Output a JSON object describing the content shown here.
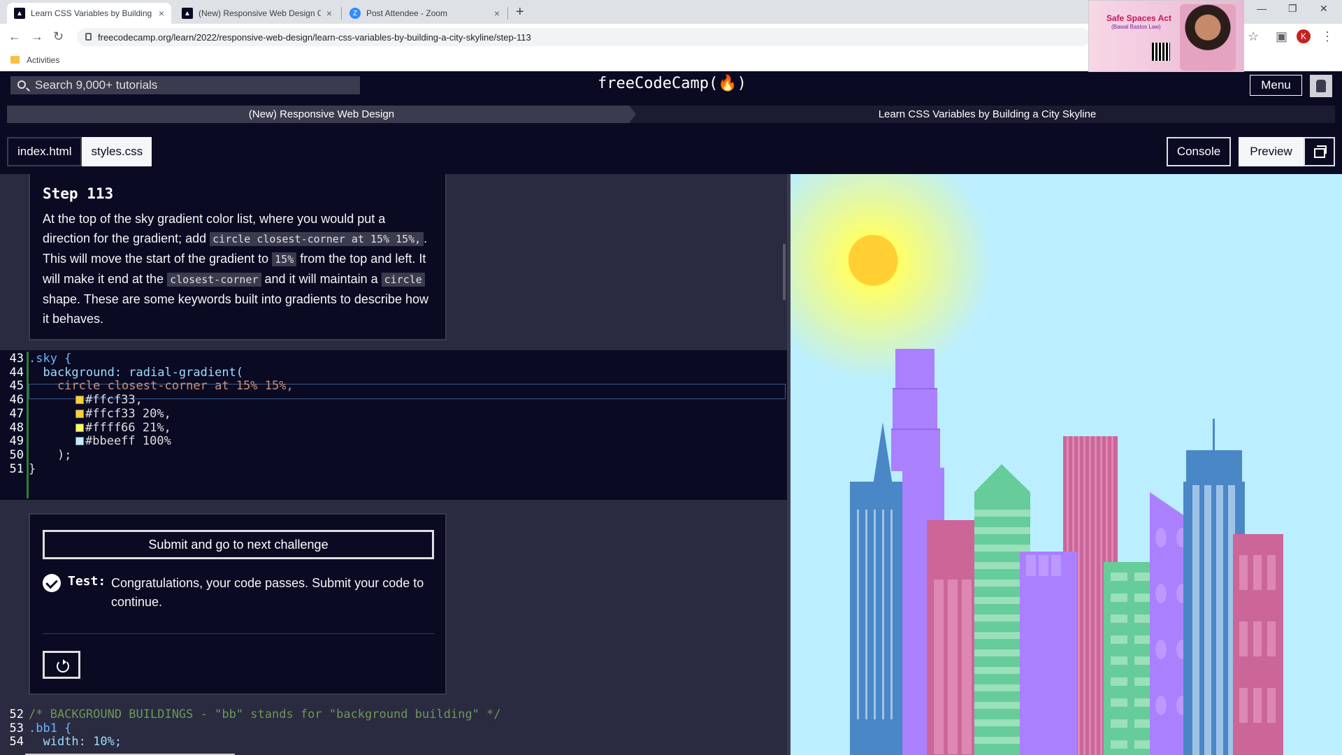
{
  "browser": {
    "tabs": [
      {
        "title": "Learn CSS Variables by Building a",
        "close": "×",
        "favicon": "fcc-icon"
      },
      {
        "title": "(New) Responsive Web Design C",
        "close": "×",
        "favicon": "fcc-icon"
      },
      {
        "title": "Post Attendee - Zoom",
        "close": "×",
        "favicon": "zoom-icon"
      }
    ],
    "new_tab": "+",
    "url": "freecodecamp.org/learn/2022/responsive-web-design/learn-css-variables-by-building-a-city-skyline/step-113",
    "bookmark": "Activities",
    "profile_initial": "K"
  },
  "zoom_overlay": {
    "title": "Safe Spaces Act",
    "subtitle": "(Bawal Bastos Law)"
  },
  "nav": {
    "search_placeholder": "Search 9,000+ tutorials",
    "logo": "freeCodeCamp(🔥)",
    "menu": "Menu"
  },
  "breadcrumb": {
    "course": "(New) Responsive Web Design",
    "project": "Learn CSS Variables by Building a City Skyline"
  },
  "toolbar": {
    "file_tabs": [
      "index.html",
      "styles.css"
    ],
    "console": "Console",
    "preview": "Preview"
  },
  "step": {
    "title": "Step 113",
    "text_1": "At the top of the sky gradient color list, where you would put a direction for the gradient; add ",
    "code_1": "circle closest-corner at 15% 15%,",
    "text_2": ". This will move the start of the gradient to ",
    "code_2": "15%",
    "text_3": " from the top and left. It will make it end at the ",
    "code_3": "closest-corner",
    "text_4": " and it will maintain a ",
    "code_4": "circle",
    "text_5": " shape. These are some keywords built into gradients to describe how it behaves."
  },
  "code_lines": [
    {
      "n": "43",
      "t": ".sky {"
    },
    {
      "n": "44",
      "t": "  background: radial-gradient("
    },
    {
      "n": "45",
      "t": "    circle closest-corner at 15% 15%,"
    },
    {
      "n": "46",
      "t": "#ffcf33,",
      "swatch": "#ffcf33"
    },
    {
      "n": "47",
      "t": "#ffcf33 20%,",
      "swatch": "#ffcf33"
    },
    {
      "n": "48",
      "t": "#ffff66 21%,",
      "swatch": "#ffff66"
    },
    {
      "n": "49",
      "t": "#bbeeff 100%",
      "swatch": "#bbeeff"
    },
    {
      "n": "50",
      "t": "    );"
    },
    {
      "n": "51",
      "t": "}"
    }
  ],
  "test": {
    "submit": "Submit and go to next challenge",
    "label": "Test:",
    "message": "Congratulations, your code passes. Submit your code to continue."
  },
  "code_lines_2": [
    {
      "n": "52",
      "t": "/* BACKGROUND BUILDINGS - \"bb\" stands for \"background building\" */"
    },
    {
      "n": "53",
      "t": ".bb1 {"
    },
    {
      "n": "54",
      "t": "  width: 10%;"
    }
  ],
  "colors": {
    "sky": "#bbeeff",
    "sun": "#ffcf33",
    "blue_building": "#4a87c7",
    "purple_building": "#aa80ff",
    "pink_building": "#cc6699",
    "green_building": "#66cc99"
  }
}
